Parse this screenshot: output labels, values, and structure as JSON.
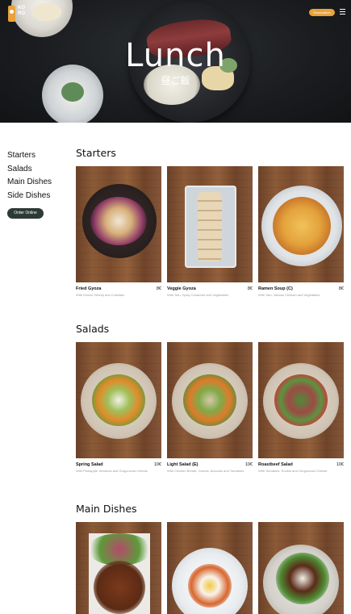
{
  "header": {
    "logo_text": "KO RO",
    "reserve_label": "Reservation",
    "title": "Lunch",
    "subtitle": "昼ご飯"
  },
  "sidebar": {
    "items": [
      {
        "label": "Starters"
      },
      {
        "label": "Salads"
      },
      {
        "label": "Main Dishes"
      },
      {
        "label": "Side Dishes"
      }
    ],
    "order_label": "Order Online"
  },
  "sections": [
    {
      "title": "Starters",
      "items": [
        {
          "name": "Fried Gyoza",
          "price": "8€",
          "desc": "With Kimchi Shrimp and Coleslaw"
        },
        {
          "name": "Veggie Gyoza",
          "price": "8€",
          "desc": "With Tofu, Spicy Coriander and Vegetables"
        },
        {
          "name": "Ramen Soup (C)",
          "price": "8€",
          "desc": "With Tofu, Various Chicken and Vegetables"
        }
      ]
    },
    {
      "title": "Salads",
      "items": [
        {
          "name": "Spring Salad",
          "price": "10€",
          "desc": "With Pineapple, Almonds and Gorgonzola Cheese"
        },
        {
          "name": "Light Salad (E)",
          "price": "10€",
          "desc": "With Chicken Breast, Carrots, Avocado and Tomatoes"
        },
        {
          "name": "Roastbeef Salad",
          "price": "10€",
          "desc": "With Tomatoes, Rocket and Gorgonzola Cheese"
        }
      ]
    },
    {
      "title": "Main Dishes",
      "items": []
    }
  ],
  "colors": {
    "accent": "#e8a23a",
    "order_button": "#2d3a36"
  }
}
